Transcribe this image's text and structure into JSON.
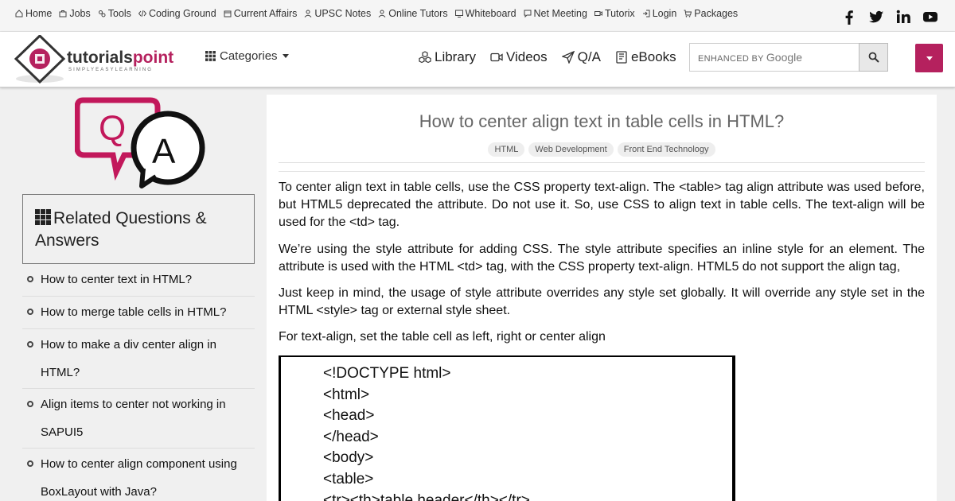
{
  "top_nav": [
    {
      "label": "Home",
      "icon": "home-icon"
    },
    {
      "label": "Jobs",
      "icon": "briefcase-icon"
    },
    {
      "label": "Tools",
      "icon": "gears-icon"
    },
    {
      "label": "Coding Ground",
      "icon": "code-icon"
    },
    {
      "label": "Current Affairs",
      "icon": "book-icon"
    },
    {
      "label": "UPSC Notes",
      "icon": "user-tie-icon"
    },
    {
      "label": "Online Tutors",
      "icon": "user-icon"
    },
    {
      "label": "Whiteboard",
      "icon": "chalkboard-icon"
    },
    {
      "label": "Net Meeting",
      "icon": "chat-icon"
    },
    {
      "label": "Tutorix",
      "icon": "video-icon"
    },
    {
      "label": "Login",
      "icon": "login-icon"
    },
    {
      "label": "Packages",
      "icon": "cart-icon"
    }
  ],
  "social": [
    "facebook-icon",
    "twitter-icon",
    "linkedin-icon",
    "youtube-icon"
  ],
  "header": {
    "logo_text": "tutorialspoint",
    "logo_tagline": "SIMPLYEASYLEARNING",
    "categories_label": "Categories",
    "nav": [
      {
        "label": "Library",
        "icon": "cubes-icon"
      },
      {
        "label": "Videos",
        "icon": "video-icon"
      },
      {
        "label": "Q/A",
        "icon": "paper-plane-icon"
      },
      {
        "label": "eBooks",
        "icon": "book-icon"
      }
    ],
    "search_enhanced": "ENHANCED BY",
    "search_brand": "Google",
    "accent_color": "#b5215e"
  },
  "sidebar": {
    "related_title": "Related Questions & Answers",
    "items": [
      "How to center text in HTML?",
      "How to merge table cells in HTML?",
      "How to make a div center align in HTML?",
      "Align items to center not working in SAPUI5",
      "How to center align component using BoxLayout with Java?"
    ]
  },
  "article": {
    "title": "How to center align text in table cells in HTML?",
    "tags": [
      "HTML",
      "Web Development",
      "Front End Technology"
    ],
    "paragraphs": [
      "To center align text in table cells, use the CSS property text-align. The <table> tag align attribute was used before, but HTML5 deprecated the attribute. Do not use it. So, use CSS to align text in table cells. The text-align will be used for the <td> tag.",
      "We’re using the style attribute for adding CSS. The style attribute specifies an inline style for an element. The attribute is used with the HTML <td> tag, with the CSS property text-align. HTML5 do not support the align tag,",
      "Just keep in mind, the usage of style attribute overrides any style set globally. It will override any style set in the HTML <style> tag or external style sheet.",
      "For text-align, set the table cell as left, right or center align"
    ],
    "code_lines": [
      "<!DOCTYPE html>",
      "<html>",
      "<head>",
      "</head>",
      "<body>",
      "<table>",
      "<tr><th>table header</th></tr>"
    ]
  }
}
